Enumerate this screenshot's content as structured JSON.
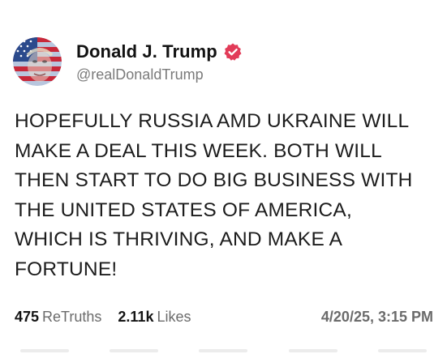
{
  "author": {
    "display_name": "Donald J. Trump",
    "handle": "@realDonaldTrump",
    "verified_color": "#e23b58"
  },
  "post": {
    "text": "HOPEFULLY RUSSIA AMD UKRAINE WILL\nMAKE A DEAL THIS WEEK. BOTH WILL\nTHEN START TO DO BIG BUSINESS WITH\nTHE UNITED STATES OF AMERICA,\nWHICH IS THRIVING, AND MAKE A\nFORTUNE!"
  },
  "stats": {
    "retruths_count": "475",
    "retruths_label": "ReTruths",
    "likes_count": "2.11k",
    "likes_label": "Likes",
    "timestamp": "4/20/25, 3:15 PM"
  },
  "icons": {
    "avatar": "flag-portrait-avatar",
    "verified": "verified-badge-icon"
  }
}
